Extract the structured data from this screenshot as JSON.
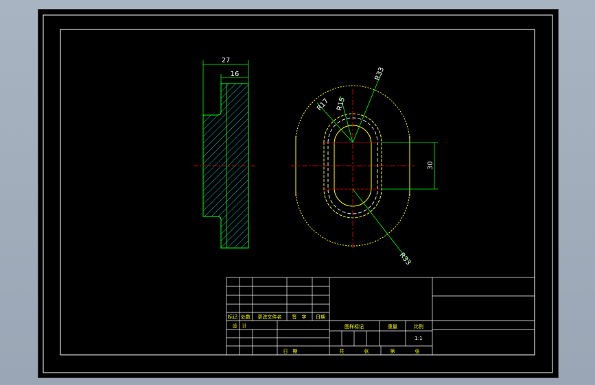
{
  "colors": {
    "background": "#000000",
    "frame": "#ffffff",
    "outline": "#ffff00",
    "dimension": "#00ff00",
    "centerline": "#ff0000",
    "hatch": "#00ffff",
    "titleblock_text": "#ffff00"
  },
  "dimensions": {
    "overall_width": "27",
    "flange_width": "16",
    "slot_height": "30",
    "radius_outer": "R33",
    "radius_mid": "R17",
    "radius_inner": "R15",
    "radius_lower": "R33"
  },
  "title_block": {
    "rev_mark": "标记",
    "rev_count": "处数",
    "rev_doc": "更改文件名",
    "rev_sign": "签　字",
    "rev_date": "日期",
    "designer": "设　计",
    "date_label": "日　期",
    "stage_mark": "图样标记",
    "weight": "重量",
    "scale": "比例",
    "scale_value": "1:1",
    "total": "共",
    "sheets": "张",
    "sheet_no": "第",
    "sheet_unit": "张"
  }
}
